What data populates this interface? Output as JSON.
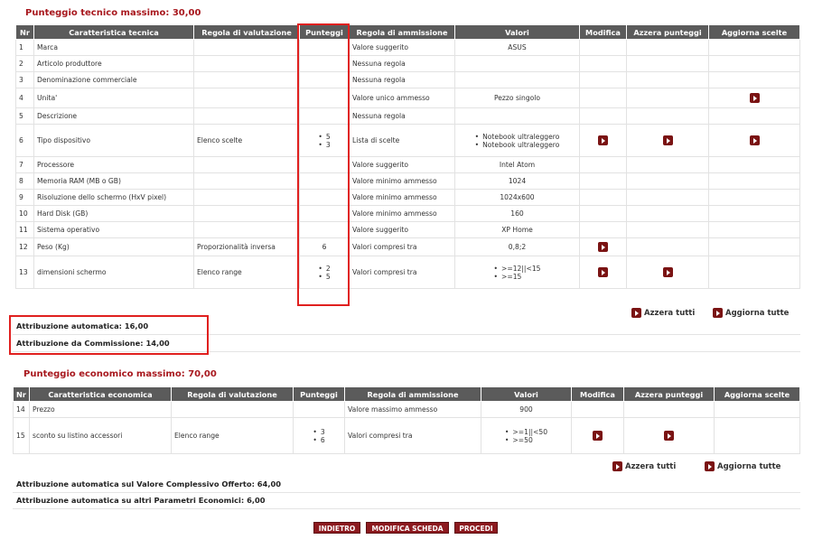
{
  "tech": {
    "title": "Punteggio tecnico massimo: 30,00",
    "headers": [
      "Nr",
      "Caratteristica tecnica",
      "Regola di valutazione",
      "Punteggi",
      "Regola di ammissione",
      "Valori",
      "Modifica",
      "Azzera punteggi",
      "Aggiorna scelte"
    ],
    "rows": [
      {
        "nr": "1",
        "name": "Marca",
        "rule": "",
        "scores": [],
        "adm": "Valore suggerito",
        "values": [
          "ASUS"
        ],
        "modify": false,
        "reset": false,
        "update": false
      },
      {
        "nr": "2",
        "name": "Articolo produttore",
        "rule": "",
        "scores": [],
        "adm": "Nessuna regola",
        "values": [],
        "modify": false,
        "reset": false,
        "update": false
      },
      {
        "nr": "3",
        "name": "Denominazione commerciale",
        "rule": "",
        "scores": [],
        "adm": "Nessuna regola",
        "values": [],
        "modify": false,
        "reset": false,
        "update": false
      },
      {
        "nr": "4",
        "name": "Unita'",
        "rule": "",
        "scores": [],
        "adm": "Valore unico ammesso",
        "values": [
          "Pezzo singolo"
        ],
        "modify": false,
        "reset": false,
        "update": true
      },
      {
        "nr": "5",
        "name": "Descrizione",
        "rule": "",
        "scores": [],
        "adm": "Nessuna regola",
        "values": [],
        "modify": false,
        "reset": false,
        "update": false
      },
      {
        "nr": "6",
        "name": "Tipo dispositivo",
        "rule": "Elenco scelte",
        "scores": [
          "5",
          "3"
        ],
        "adm": "Lista di scelte",
        "values": [
          "Notebook ultraleggero",
          "Notebook ultraleggero"
        ],
        "modify": true,
        "reset": true,
        "update": true
      },
      {
        "nr": "7",
        "name": "Processore",
        "rule": "",
        "scores": [],
        "adm": "Valore suggerito",
        "values": [
          "Intel Atom"
        ],
        "modify": false,
        "reset": false,
        "update": false
      },
      {
        "nr": "8",
        "name": "Memoria RAM (MB o GB)",
        "rule": "",
        "scores": [],
        "adm": "Valore minimo ammesso",
        "values": [
          "1024"
        ],
        "modify": false,
        "reset": false,
        "update": false
      },
      {
        "nr": "9",
        "name": "Risoluzione dello schermo (HxV pixel)",
        "rule": "",
        "scores": [],
        "adm": "Valore minimo ammesso",
        "values": [
          "1024x600"
        ],
        "modify": false,
        "reset": false,
        "update": false
      },
      {
        "nr": "10",
        "name": "Hard Disk (GB)",
        "rule": "",
        "scores": [],
        "adm": "Valore minimo ammesso",
        "values": [
          "160"
        ],
        "modify": false,
        "reset": false,
        "update": false
      },
      {
        "nr": "11",
        "name": "Sistema operativo",
        "rule": "",
        "scores": [],
        "adm": "Valore suggerito",
        "values": [
          "XP Home"
        ],
        "modify": false,
        "reset": false,
        "update": false
      },
      {
        "nr": "12",
        "name": "Peso (Kg)",
        "rule": "Proporzionalità inversa",
        "scores": [
          "6"
        ],
        "adm": "Valori compresi tra",
        "values": [
          "0,8;2"
        ],
        "modify": true,
        "reset": false,
        "update": false
      },
      {
        "nr": "13",
        "name": "dimensioni schermo",
        "rule": "Elenco range",
        "scores": [
          "2",
          "5"
        ],
        "adm": "Valori compresi tra",
        "values": [
          ">=12||<15",
          ">=15"
        ],
        "modify": true,
        "reset": true,
        "update": false
      }
    ],
    "reset_all": "Azzera tutti",
    "update_all": "Aggiorna tutte",
    "auto": "Attribuzione automatica: 16,00",
    "commission": "Attribuzione da Commissione: 14,00"
  },
  "econ": {
    "title": "Punteggio economico massimo: 70,00",
    "headers": [
      "Nr",
      "Caratteristica economica",
      "Regola di valutazione",
      "Punteggi",
      "Regola di ammissione",
      "Valori",
      "Modifica",
      "Azzera punteggi",
      "Aggiorna scelte"
    ],
    "rows": [
      {
        "nr": "14",
        "name": "Prezzo",
        "rule": "",
        "scores": [],
        "adm": "Valore massimo ammesso",
        "values": [
          "900"
        ],
        "modify": false,
        "reset": false,
        "update": false
      },
      {
        "nr": "15",
        "name": "sconto su listino accessori",
        "rule": "Elenco range",
        "scores": [
          "3",
          "6"
        ],
        "adm": "Valori compresi tra",
        "values": [
          ">=1||<50",
          ">=50"
        ],
        "modify": true,
        "reset": true,
        "update": false
      }
    ],
    "reset_all": "Azzera tutti",
    "update_all": "Aggiorna tutte",
    "total_offered": "Attribuzione automatica sul Valore Complessivo Offerto: 64,00",
    "other_params": "Attribuzione automatica su altri Parametri Economici: 6,00"
  },
  "buttons": {
    "back": "INDIETRO",
    "edit": "MODIFICA SCHEDA",
    "proceed": "PROCEDI"
  },
  "colors": {
    "accent": "#a8181e",
    "header_bg": "#5b5b5b",
    "highlight_box": "#e0201f",
    "icon": "#7a1313"
  }
}
